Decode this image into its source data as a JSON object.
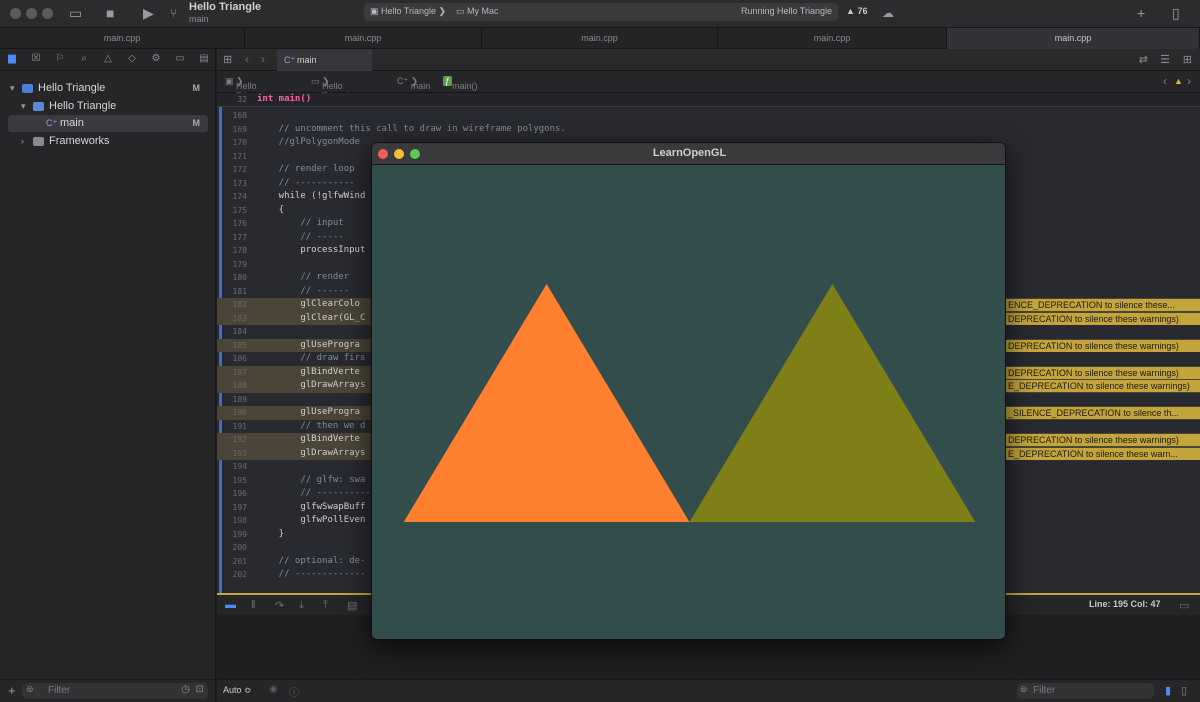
{
  "toolbar": {
    "project_title": "Hello Triangle",
    "project_subtitle": "main",
    "scheme": "Hello Triangle",
    "destination": "My Mac",
    "status": "Running Hello Triangle",
    "warning_count": "76"
  },
  "tabs": [
    "main.cpp",
    "main.cpp",
    "main.cpp",
    "main.cpp",
    "main.cpp"
  ],
  "navigator": {
    "items": [
      {
        "label": "Hello Triangle",
        "badge": "M"
      },
      {
        "label": "Hello Triangle",
        "badge": ""
      },
      {
        "label": "main",
        "badge": "M"
      },
      {
        "label": "Frameworks",
        "badge": ""
      }
    ],
    "filter_placeholder": "Filter"
  },
  "editor": {
    "tab_label": "main",
    "jumpbar": [
      "Hello Triangle",
      "Hello Triangle",
      "main",
      "main()"
    ],
    "sticky": {
      "line": "32",
      "text": "int main()"
    },
    "lines": [
      {
        "n": "168",
        "t": "",
        "c": "",
        "w": false
      },
      {
        "n": "169",
        "t": "    // uncomment this call to draw in wireframe polygons.",
        "c": "cm",
        "w": false
      },
      {
        "n": "170",
        "t": "    //glPolygonMode",
        "c": "cm",
        "w": false
      },
      {
        "n": "171",
        "t": "",
        "c": "",
        "w": false
      },
      {
        "n": "172",
        "t": "    // render loop",
        "c": "cm",
        "w": false
      },
      {
        "n": "173",
        "t": "    // -----------",
        "c": "cm",
        "w": false
      },
      {
        "n": "174",
        "t": "    while (!glfwWind",
        "c": "",
        "w": false
      },
      {
        "n": "175",
        "t": "    {",
        "c": "",
        "w": false
      },
      {
        "n": "176",
        "t": "        // input",
        "c": "cm",
        "w": false
      },
      {
        "n": "177",
        "t": "        // -----",
        "c": "cm",
        "w": false
      },
      {
        "n": "178",
        "t": "        processInput",
        "c": "",
        "w": false
      },
      {
        "n": "179",
        "t": "",
        "c": "",
        "w": false
      },
      {
        "n": "180",
        "t": "        // render",
        "c": "cm",
        "w": false
      },
      {
        "n": "181",
        "t": "        // ------",
        "c": "cm",
        "w": false
      },
      {
        "n": "182",
        "t": "        glClearColo",
        "c": "",
        "w": true
      },
      {
        "n": "183",
        "t": "        glClear(GL_C",
        "c": "",
        "w": true
      },
      {
        "n": "184",
        "t": "",
        "c": "",
        "w": false
      },
      {
        "n": "185",
        "t": "        glUseProgra",
        "c": "",
        "w": true
      },
      {
        "n": "186",
        "t": "        // draw firs",
        "c": "cm",
        "w": false
      },
      {
        "n": "187",
        "t": "        glBindVerte",
        "c": "",
        "w": true
      },
      {
        "n": "188",
        "t": "        glDrawArrays",
        "c": "",
        "w": true
      },
      {
        "n": "189",
        "t": "",
        "c": "",
        "w": false
      },
      {
        "n": "190",
        "t": "        glUseProgra",
        "c": "",
        "w": true
      },
      {
        "n": "191",
        "t": "        // then we d",
        "c": "cm",
        "w": false
      },
      {
        "n": "192",
        "t": "        glBindVerte",
        "c": "",
        "w": true
      },
      {
        "n": "193",
        "t": "        glDrawArrays",
        "c": "",
        "w": true
      },
      {
        "n": "194",
        "t": "",
        "c": "",
        "w": false
      },
      {
        "n": "195",
        "t": "        // glfw: swa",
        "c": "cm",
        "w": false
      },
      {
        "n": "196",
        "t": "        // ----------",
        "c": "cm",
        "w": false
      },
      {
        "n": "197",
        "t": "        glfwSwapBuff",
        "c": "",
        "w": false
      },
      {
        "n": "198",
        "t": "        glfwPollEven",
        "c": "",
        "w": false
      },
      {
        "n": "199",
        "t": "    }",
        "c": "",
        "w": false
      },
      {
        "n": "200",
        "t": "",
        "c": "",
        "w": false
      },
      {
        "n": "201",
        "t": "    // optional: de-",
        "c": "cm",
        "w": false
      },
      {
        "n": "202",
        "t": "    // -------------",
        "c": "cm",
        "w": false
      }
    ],
    "warnings": [
      {
        "line": "182",
        "text": "ENCE_DEPRECATION to silence these..."
      },
      {
        "line": "183",
        "text": "DEPRECATION to silence these warnings)"
      },
      {
        "line": "185",
        "text": "DEPRECATION to silence these warnings)"
      },
      {
        "line": "187",
        "text": "DEPRECATION to silence these warnings)"
      },
      {
        "line": "188",
        "text": "E_DEPRECATION to silence these warnings)"
      },
      {
        "line": "190",
        "text": "_SILENCE_DEPRECATION to silence th..."
      },
      {
        "line": "192",
        "text": "DEPRECATION to silence these warnings)"
      },
      {
        "line": "193",
        "text": "E_DEPRECATION to silence these warn..."
      }
    ]
  },
  "debug": {
    "line_col": "Line: 195  Col: 47",
    "auto": "Auto ≎",
    "filter_placeholder": "Filter"
  },
  "gl_window": {
    "title": "LearnOpenGL",
    "clear_color": "#334d4d",
    "triangles": [
      {
        "color": "#ff7f2e",
        "vertices": [
          [
            -0.9,
            -0.5
          ],
          [
            0.0,
            -0.5
          ],
          [
            -0.45,
            0.5
          ]
        ]
      },
      {
        "color": "#7f7f17",
        "vertices": [
          [
            0.0,
            -0.5
          ],
          [
            0.9,
            -0.5
          ],
          [
            0.45,
            0.5
          ]
        ]
      }
    ]
  }
}
